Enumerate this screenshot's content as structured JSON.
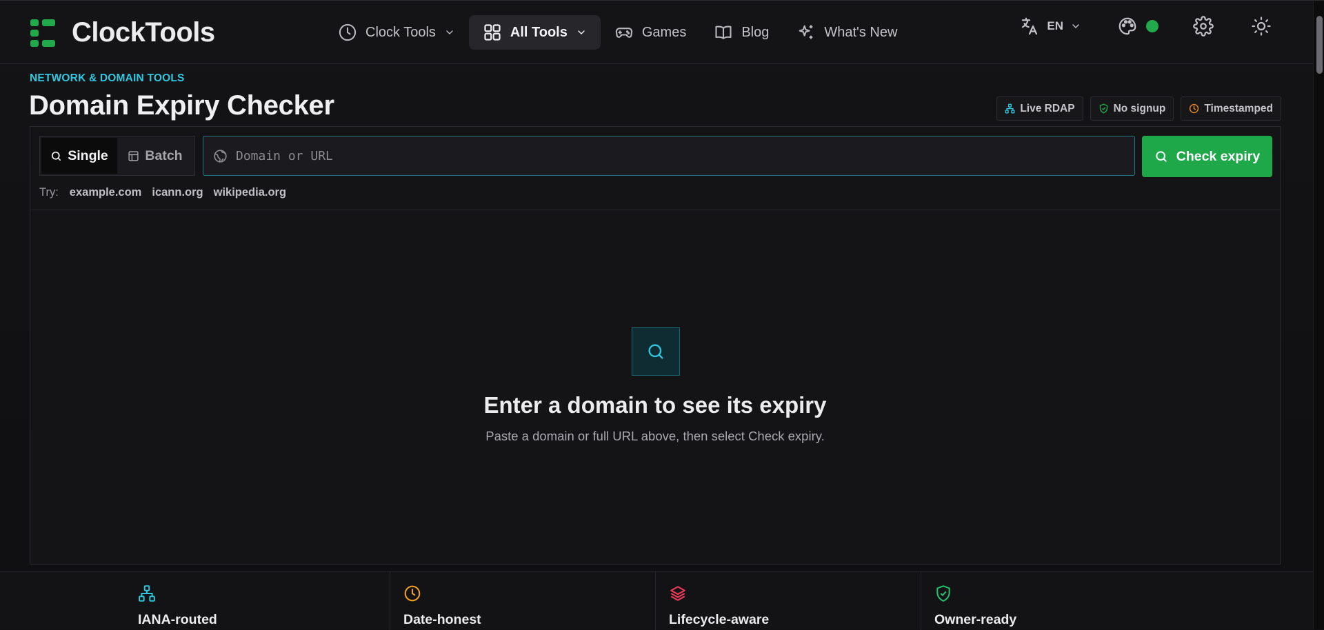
{
  "app": {
    "name": "ClockTools",
    "brand_color": "#22a94c"
  },
  "nav": {
    "items": [
      {
        "label": "Clock Tools",
        "icon": "clock-icon",
        "has_dropdown": true
      },
      {
        "label": "All Tools",
        "icon": "grid-icon",
        "has_dropdown": true,
        "active": true
      },
      {
        "label": "Games",
        "icon": "gamepad-icon"
      },
      {
        "label": "Blog",
        "icon": "book-icon"
      },
      {
        "label": "What's New",
        "icon": "sparkles-icon"
      }
    ],
    "language": "EN",
    "theme_dot_color": "#22a94c"
  },
  "page": {
    "eyebrow": "NETWORK & DOMAIN TOOLS",
    "title": "Domain Expiry Checker",
    "badges": [
      {
        "label": "Live RDAP",
        "icon": "network-icon",
        "color": "#2ec8e0"
      },
      {
        "label": "No signup",
        "icon": "shield-check-icon",
        "color": "#22a94c"
      },
      {
        "label": "Timestamped",
        "icon": "clock-icon",
        "color": "#f08a24"
      }
    ]
  },
  "tool": {
    "modes": [
      {
        "label": "Single",
        "icon": "search-icon",
        "active": true
      },
      {
        "label": "Batch",
        "icon": "table-icon",
        "active": false
      }
    ],
    "input": {
      "placeholder": "Domain or URL",
      "value": ""
    },
    "submit_label": "Check expiry",
    "try_label": "Try:",
    "examples": [
      "example.com",
      "icann.org",
      "wikipedia.org"
    ],
    "empty_state": {
      "title": "Enter a domain to see its expiry",
      "subtitle": "Paste a domain or full URL above, then select Check expiry."
    }
  },
  "features": [
    {
      "title": "IANA-routed",
      "icon": "network-icon",
      "color": "#2ec8e0"
    },
    {
      "title": "Date-honest",
      "icon": "clock-icon",
      "color": "#f0a020"
    },
    {
      "title": "Lifecycle-aware",
      "icon": "layers-icon",
      "color": "#f03a5a"
    },
    {
      "title": "Owner-ready",
      "icon": "shield-check-icon",
      "color": "#22c070"
    }
  ]
}
